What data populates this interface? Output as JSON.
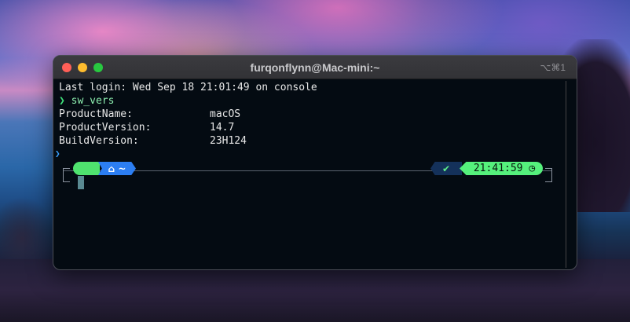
{
  "window": {
    "title": "furqonflynn@Mac-mini:~",
    "shortcut": "⌥⌘1"
  },
  "terminal": {
    "last_login": "Last login: Wed Sep 18 21:01:49 on console",
    "prompt_symbol": "❯",
    "command": "sw_vers",
    "output": [
      {
        "key": "ProductName:",
        "value": "macOS"
      },
      {
        "key": "ProductVersion:",
        "value": "14.7"
      },
      {
        "key": "BuildVersion:",
        "value": "23H124"
      }
    ],
    "side_marker": "❯"
  },
  "prompt": {
    "os_icon": "",
    "home_icon": "⌂",
    "home_label": "~",
    "status_icon": "✔",
    "time": "21:41:59",
    "clock_icon": "◷"
  },
  "colors": {
    "prompt_green": "#4fe36e",
    "prompt_blue": "#2c7ef2",
    "terminal_bg": "#040b12"
  }
}
